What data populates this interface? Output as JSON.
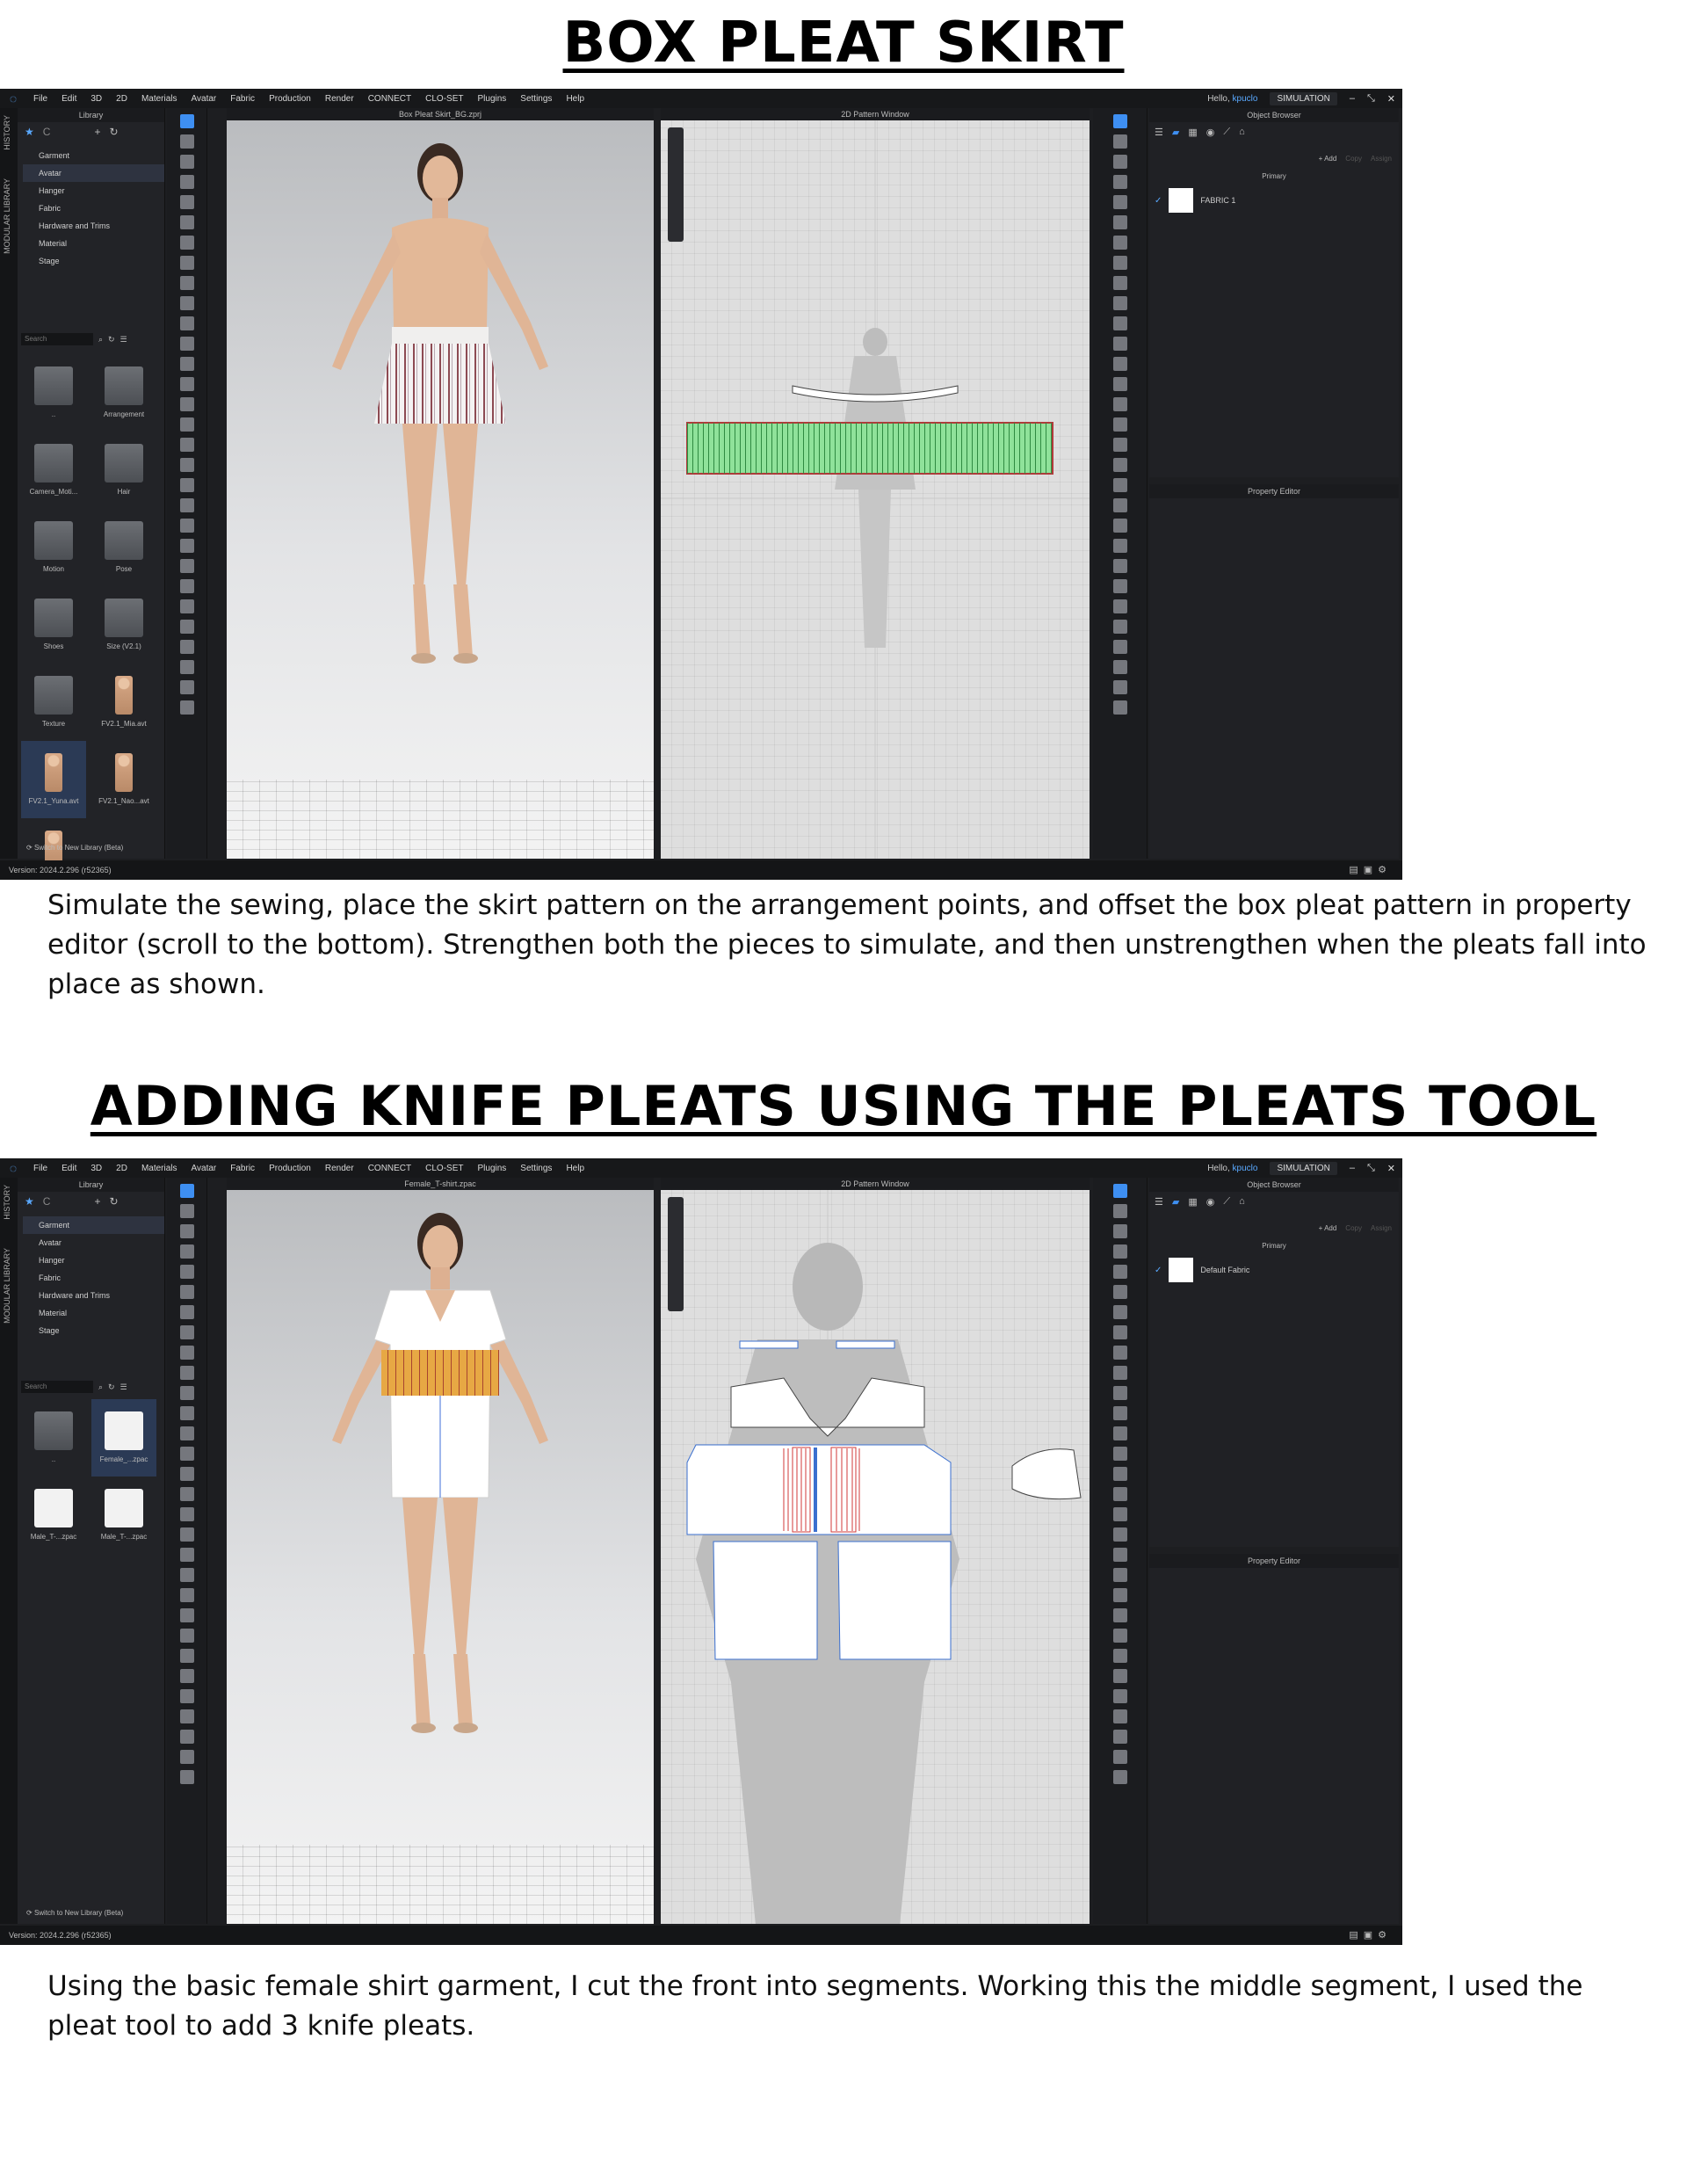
{
  "headings": {
    "box_pleat": "BOX PLEAT SKIRT",
    "knife_pleats": "ADDING KNIFE PLEATS USING THE PLEATS TOOL"
  },
  "captions": {
    "box_pleat": "Simulate the sewing, place the skirt pattern on the arrangement points, and offset the box pleat pattern in property editor (scroll to the bottom). Strengthen both the pieces to simulate, and then unstrengthen when the pleats fall into place as shown.",
    "knife_pleats": "Using the basic female shirt garment, I cut the front into segments. Working this the middle segment, I used the pleat tool to add 3 knife pleats."
  },
  "app": {
    "menu": [
      "File",
      "Edit",
      "3D",
      "2D",
      "Materials",
      "Avatar",
      "Fabric",
      "Production",
      "Render",
      "CONNECT",
      "CLO-SET",
      "Plugins",
      "Settings",
      "Help"
    ],
    "greeting": "Hello,",
    "username": "kpuclo",
    "mode": "SIMULATION",
    "side_tabs": [
      "HISTORY",
      "MODULAR LIBRARY"
    ],
    "library_title": "Library",
    "library_tree": [
      "Garment",
      "Avatar",
      "Hanger",
      "Fabric",
      "Hardware and Trims",
      "Material",
      "Stage"
    ],
    "search_placeholder": "Search",
    "switch_library": "Switch to New Library (Beta)",
    "pattern_window_title": "2D Pattern Window",
    "object_browser_title": "Object Browser",
    "add_label": "Add",
    "copy_label": "Copy",
    "assign_label": "Assign",
    "primary_label": "Primary",
    "property_editor_title": "Property Editor",
    "version": "Version: 2024.2.296 (r52365)"
  },
  "screen1": {
    "file_title": "Box Pleat Skirt_BG.zprj",
    "fabric_name": "FABRIC 1",
    "library_items": [
      {
        "label": "..",
        "type": "folder"
      },
      {
        "label": "Arrangement",
        "type": "folder"
      },
      {
        "label": "Camera_Moti...",
        "type": "folder"
      },
      {
        "label": "Hair",
        "type": "folder"
      },
      {
        "label": "Motion",
        "type": "folder"
      },
      {
        "label": "Pose",
        "type": "folder"
      },
      {
        "label": "Shoes",
        "type": "folder"
      },
      {
        "label": "Size (V2.1)",
        "type": "folder"
      },
      {
        "label": "Texture",
        "type": "folder"
      },
      {
        "label": "FV2.1_Mia.avt",
        "type": "person"
      },
      {
        "label": "FV2.1_Yuna.avt",
        "type": "person"
      },
      {
        "label": "FV2.1_Nao...avt",
        "type": "person"
      },
      {
        "label": "FV2.1_Mia.avt",
        "type": "person"
      }
    ]
  },
  "screen2": {
    "file_title": "Female_T-shirt.zpac",
    "fabric_name": "Default Fabric",
    "library_items": [
      {
        "label": "..",
        "type": "folder"
      },
      {
        "label": "Female_...zpac",
        "type": "shirt"
      },
      {
        "label": "Male_T-...zpac",
        "type": "shirt"
      },
      {
        "label": "Male_T-...zpac",
        "type": "shirt"
      }
    ]
  },
  "colors": {
    "app_bg": "#1d1e21",
    "accent": "#3e8ff2",
    "skirt_pattern": "#8fe29a",
    "pleat_panel": "#e7a844",
    "pleat_line": "#d03a3a"
  }
}
